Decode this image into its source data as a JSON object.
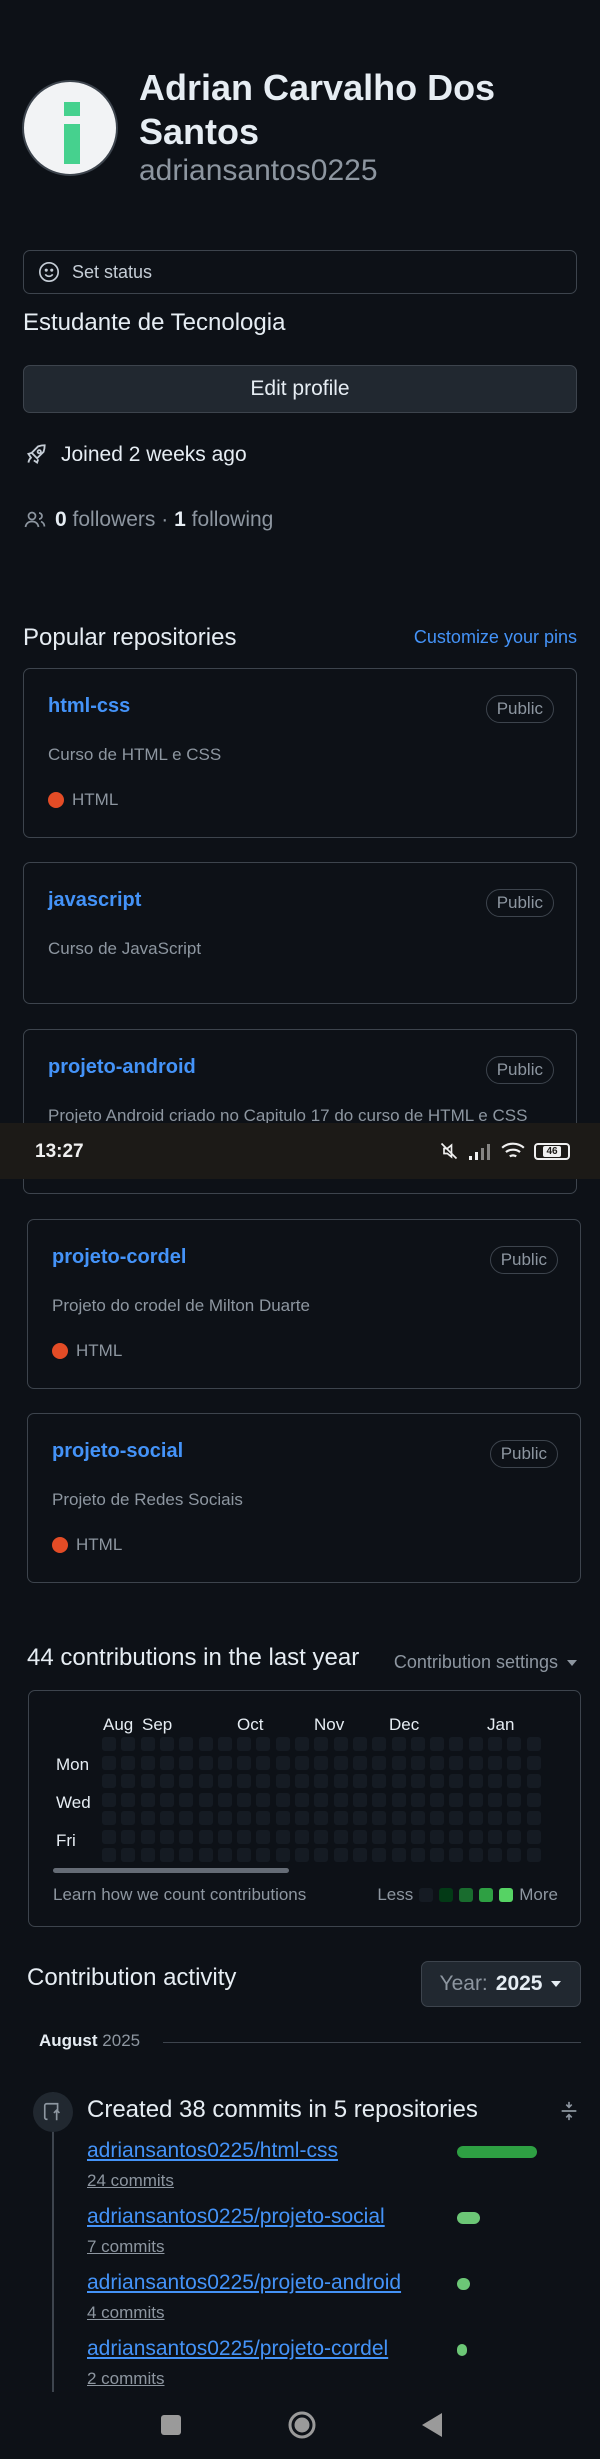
{
  "profile": {
    "name": "Adrian Carvalho Dos Santos",
    "username": "adriansantos0225",
    "status_label": "Set status",
    "bio": "Estudante de Tecnologia",
    "edit_label": "Edit profile",
    "joined": "Joined 2 weeks ago",
    "followers_count": "0",
    "followers_label": "followers",
    "separator": "·",
    "following_count": "1",
    "following_label": "following"
  },
  "popular": {
    "title": "Popular repositories",
    "customize_label": "Customize your pins",
    "repos": [
      {
        "name": "html-css",
        "visibility": "Public",
        "description": "Curso de HTML e CSS",
        "language": "HTML"
      },
      {
        "name": "javascript",
        "visibility": "Public",
        "description": "Curso de JavaScript",
        "language": ""
      },
      {
        "name": "projeto-android",
        "visibility": "Public",
        "description": "Projeto Android criado no Capitulo 17 do curso de HTML e CSS",
        "language": ""
      },
      {
        "name": "projeto-cordel",
        "visibility": "Public",
        "description": "Projeto do crodel de Milton Duarte",
        "language": "HTML"
      },
      {
        "name": "projeto-social",
        "visibility": "Public",
        "description": "Projeto de Redes Sociais",
        "language": "HTML"
      }
    ]
  },
  "statusbar": {
    "time": "13:27",
    "battery": "46"
  },
  "contributions": {
    "title": "44 contributions in the last year",
    "settings_label": "Contribution settings",
    "months": [
      "Aug",
      "Sep",
      "Oct",
      "Nov",
      "Dec",
      "Jan"
    ],
    "days": [
      "Mon",
      "Wed",
      "Fri"
    ],
    "learn_label": "Learn how we count contributions",
    "less_label": "Less",
    "more_label": "More"
  },
  "activity": {
    "title": "Contribution activity",
    "year_label": "Year:",
    "year_value": "2025",
    "month_name": "August",
    "month_year": "2025",
    "commit_header": "Created 38 commits in 5 repositories",
    "rows": [
      {
        "repo": "adriansantos0225/html-css",
        "commits": "24 commits",
        "share": 24
      },
      {
        "repo": "adriansantos0225/projeto-social",
        "commits": "7 commits",
        "share": 7
      },
      {
        "repo": "adriansantos0225/projeto-android",
        "commits": "4 commits",
        "share": 4
      },
      {
        "repo": "adriansantos0225/projeto-cordel",
        "commits": "2 commits",
        "share": 2
      }
    ]
  },
  "colors": {
    "accent": "#4493f8",
    "html_lang": "#e34c26",
    "contrib_green": "#56d364",
    "background": "#0d1117"
  }
}
